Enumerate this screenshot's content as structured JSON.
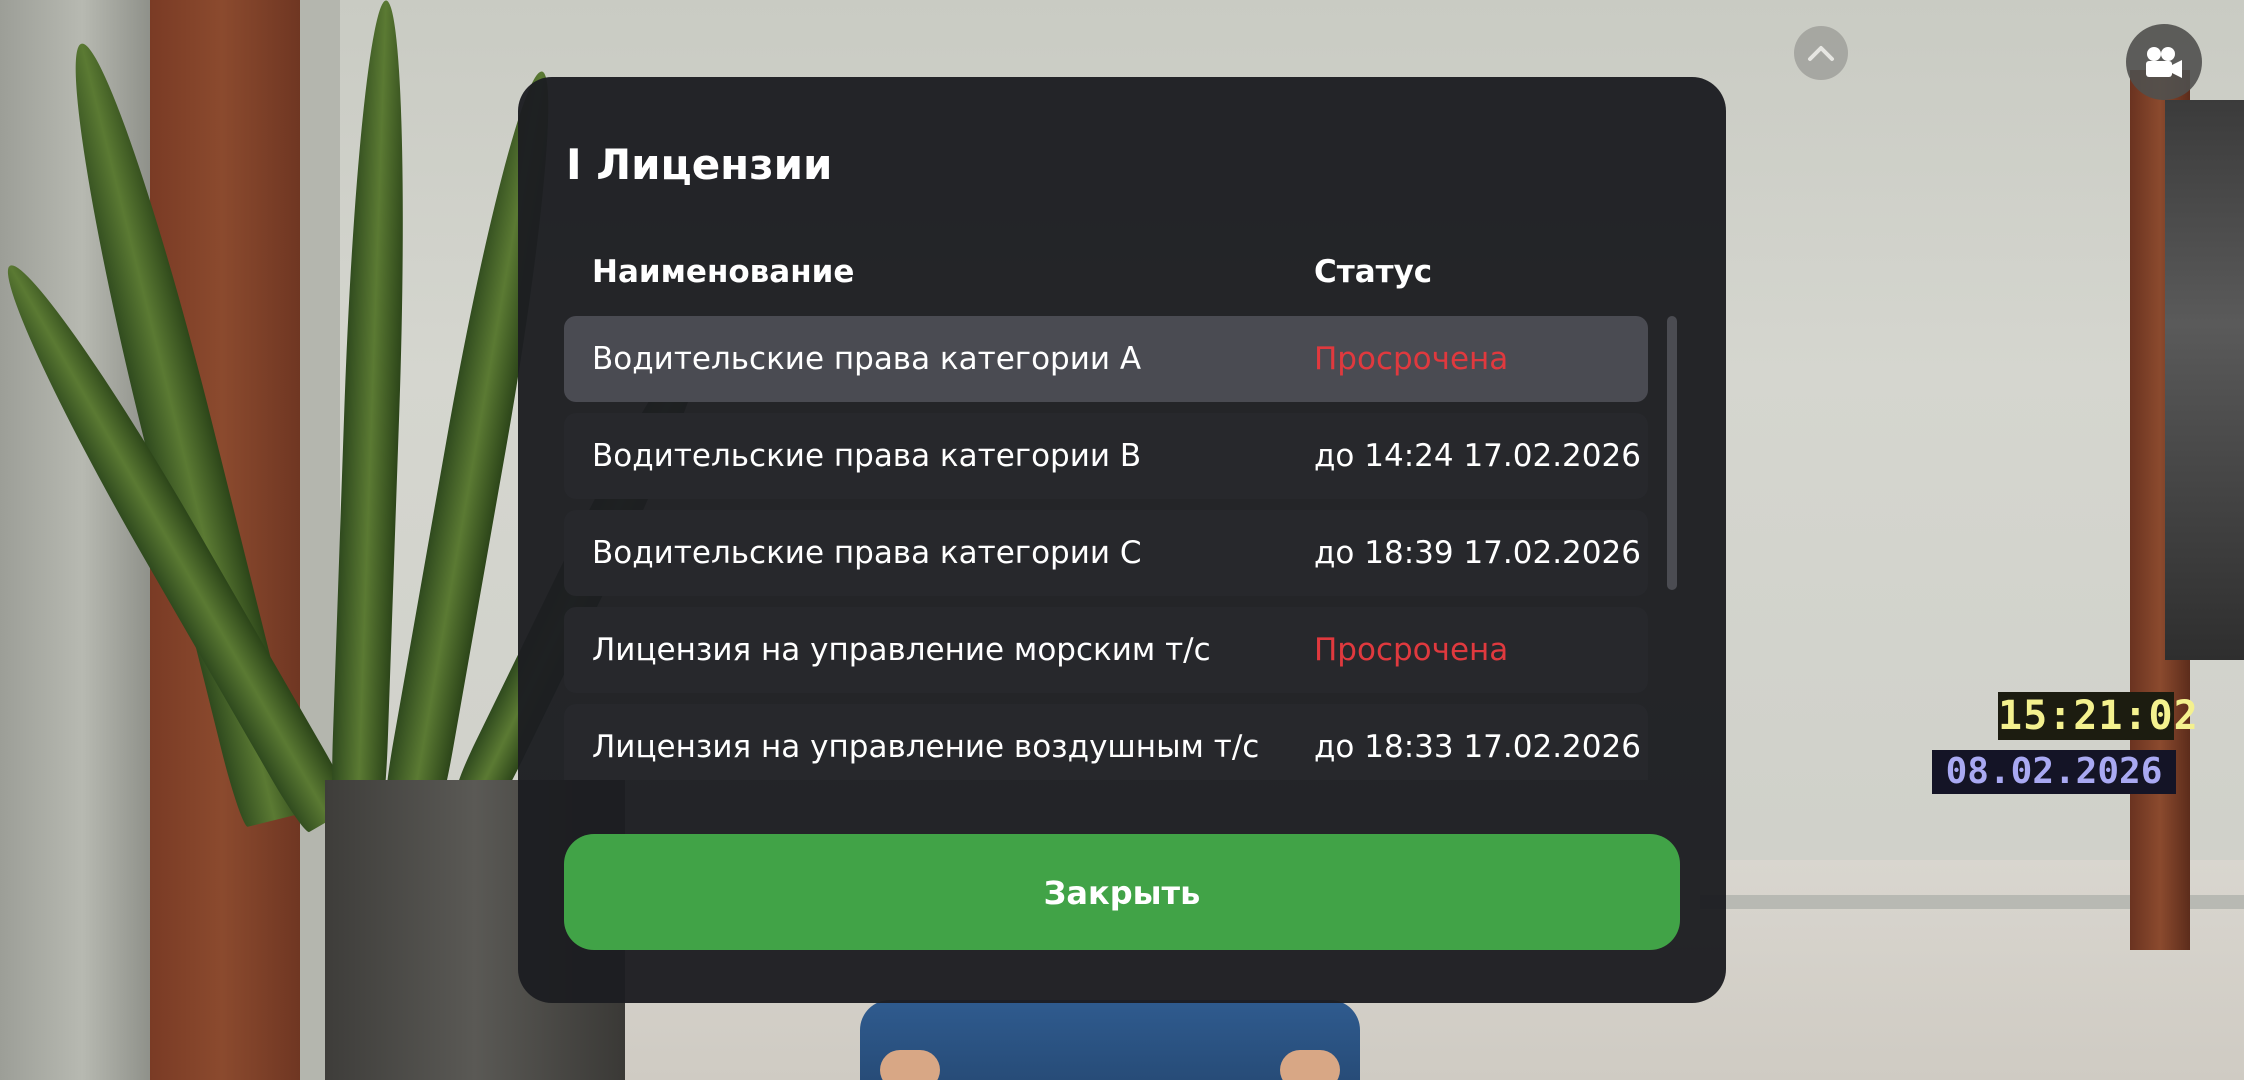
{
  "modal": {
    "title": "I Лицензии",
    "columns": {
      "name": "Наименование",
      "status": "Статус"
    },
    "rows": [
      {
        "name": "Водительские права категории A",
        "status": "Просрочена",
        "expired": true
      },
      {
        "name": "Водительские права категории B",
        "status": "до 14:24 17.02.2026",
        "expired": false
      },
      {
        "name": "Водительские права категории C",
        "status": "до 18:39 17.02.2026",
        "expired": false
      },
      {
        "name": "Лицензия на управление морским т/с",
        "status": "Просрочена",
        "expired": true
      },
      {
        "name": "Лицензия на управление воздушным т/с",
        "status": "до 18:33 17.02.2026",
        "expired": false
      }
    ],
    "close_label": "Закрыть"
  },
  "hud": {
    "time": "15:21:02",
    "date": "08.02.2026",
    "up_icon": "chevron-up-icon",
    "camera_icon": "camera-icon"
  },
  "colors": {
    "panel": "#1c1d21",
    "row": "#27282c",
    "row_selected": "#4a4b52",
    "expired": "#e0393e",
    "close_button": "#41a347"
  }
}
